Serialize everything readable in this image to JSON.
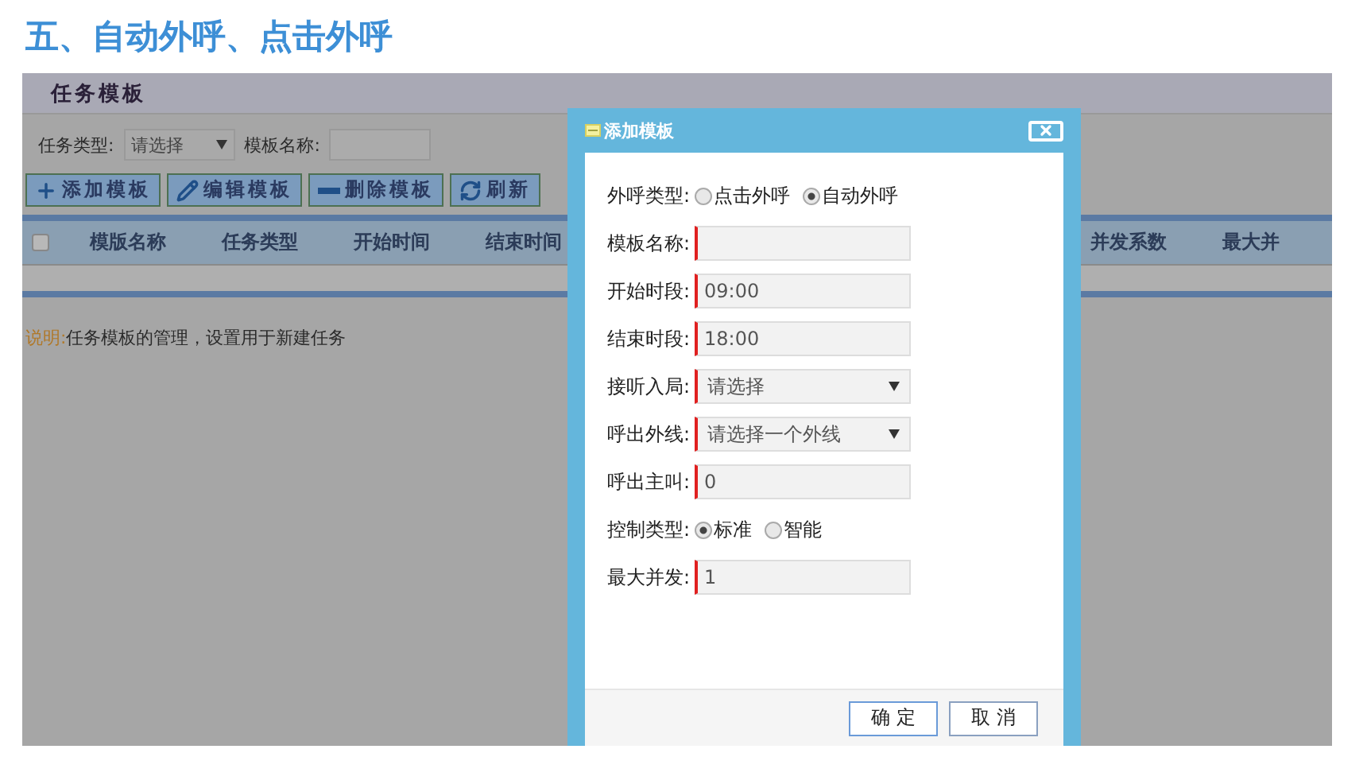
{
  "heading": "五、自动外呼、点击外呼",
  "app": {
    "title": "任务模板",
    "filters": [
      {
        "kind": "select",
        "label": "任务类型:",
        "value": "请选择"
      },
      {
        "kind": "input",
        "label": "模板名称:"
      }
    ],
    "toolbar": [
      {
        "label": "添加模板"
      },
      {
        "label": "编辑模板"
      },
      {
        "label": "删除模板"
      },
      {
        "label": "刷新"
      }
    ],
    "header_checkbox": {
      "checked": false
    },
    "columns_left": [
      "模版名称",
      "任务类型",
      "开始时间",
      "结束时间"
    ],
    "columns_right": [
      "并发系数",
      "最大并"
    ],
    "note": {
      "label": "说明:",
      "text": "任务模板的管理，设置用于新建任务"
    }
  },
  "dialog": {
    "title": "添加模板",
    "rows": [
      {
        "kind": "radio",
        "label": "外呼类型:",
        "options": [
          {
            "label": "点击外呼",
            "selected": false
          },
          {
            "label": "自动外呼",
            "selected": true
          }
        ]
      },
      {
        "kind": "input",
        "label": "模板名称:"
      },
      {
        "kind": "input",
        "label": "开始时段:",
        "value": "09:00"
      },
      {
        "kind": "input",
        "label": "结束时段:",
        "value": "18:00"
      },
      {
        "kind": "select",
        "label": "接听入局:",
        "value": "请选择"
      },
      {
        "kind": "select",
        "label": "呼出外线:",
        "value": "请选择一个外线"
      },
      {
        "kind": "input",
        "label": "呼出主叫:",
        "value": "0"
      },
      {
        "kind": "radio",
        "label": "控制类型:",
        "options": [
          {
            "label": "标准",
            "selected": true
          },
          {
            "label": "智能",
            "selected": false
          }
        ]
      },
      {
        "kind": "input",
        "label": "最大并发:",
        "value": "1"
      }
    ],
    "buttons": [
      "确 定",
      "取 消"
    ]
  }
}
